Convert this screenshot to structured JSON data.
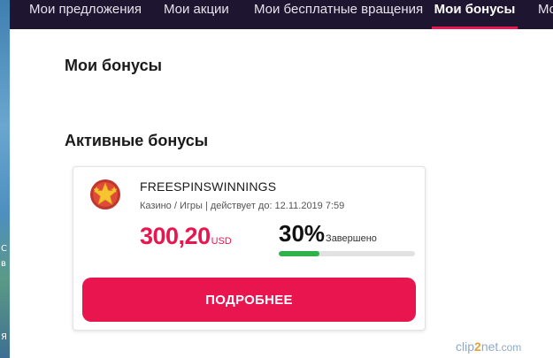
{
  "desktop_strip": {
    "letters": [
      "C",
      "в",
      "Я"
    ]
  },
  "nav": {
    "tabs": [
      {
        "label": "Мои предложения",
        "active": false
      },
      {
        "label": "Мои акции",
        "active": false
      },
      {
        "label": "Мои бесплатные вращения",
        "active": false
      },
      {
        "label": "Мои бонусы",
        "active": true
      },
      {
        "label": "Мо",
        "active": false
      }
    ]
  },
  "page": {
    "title": "Мои бонусы",
    "section_title": "Активные бонусы"
  },
  "bonus_card": {
    "icon": "star-badge-icon",
    "name": "FREESPINSWINNINGS",
    "meta": "Казино / Игры | действует до: 12.11.2019 7:59",
    "amount": "300,20",
    "currency": "USD",
    "progress_percent": "30%",
    "progress_value": 0.3,
    "status": "Завершено",
    "button_label": "ПОДРОБНЕЕ"
  },
  "watermark": {
    "text_parts": [
      "clip",
      "2",
      "net",
      ".com"
    ]
  },
  "colors": {
    "nav_bg": "#1e1530",
    "accent": "#e9154f",
    "progress_fill": "#2fb24a"
  }
}
